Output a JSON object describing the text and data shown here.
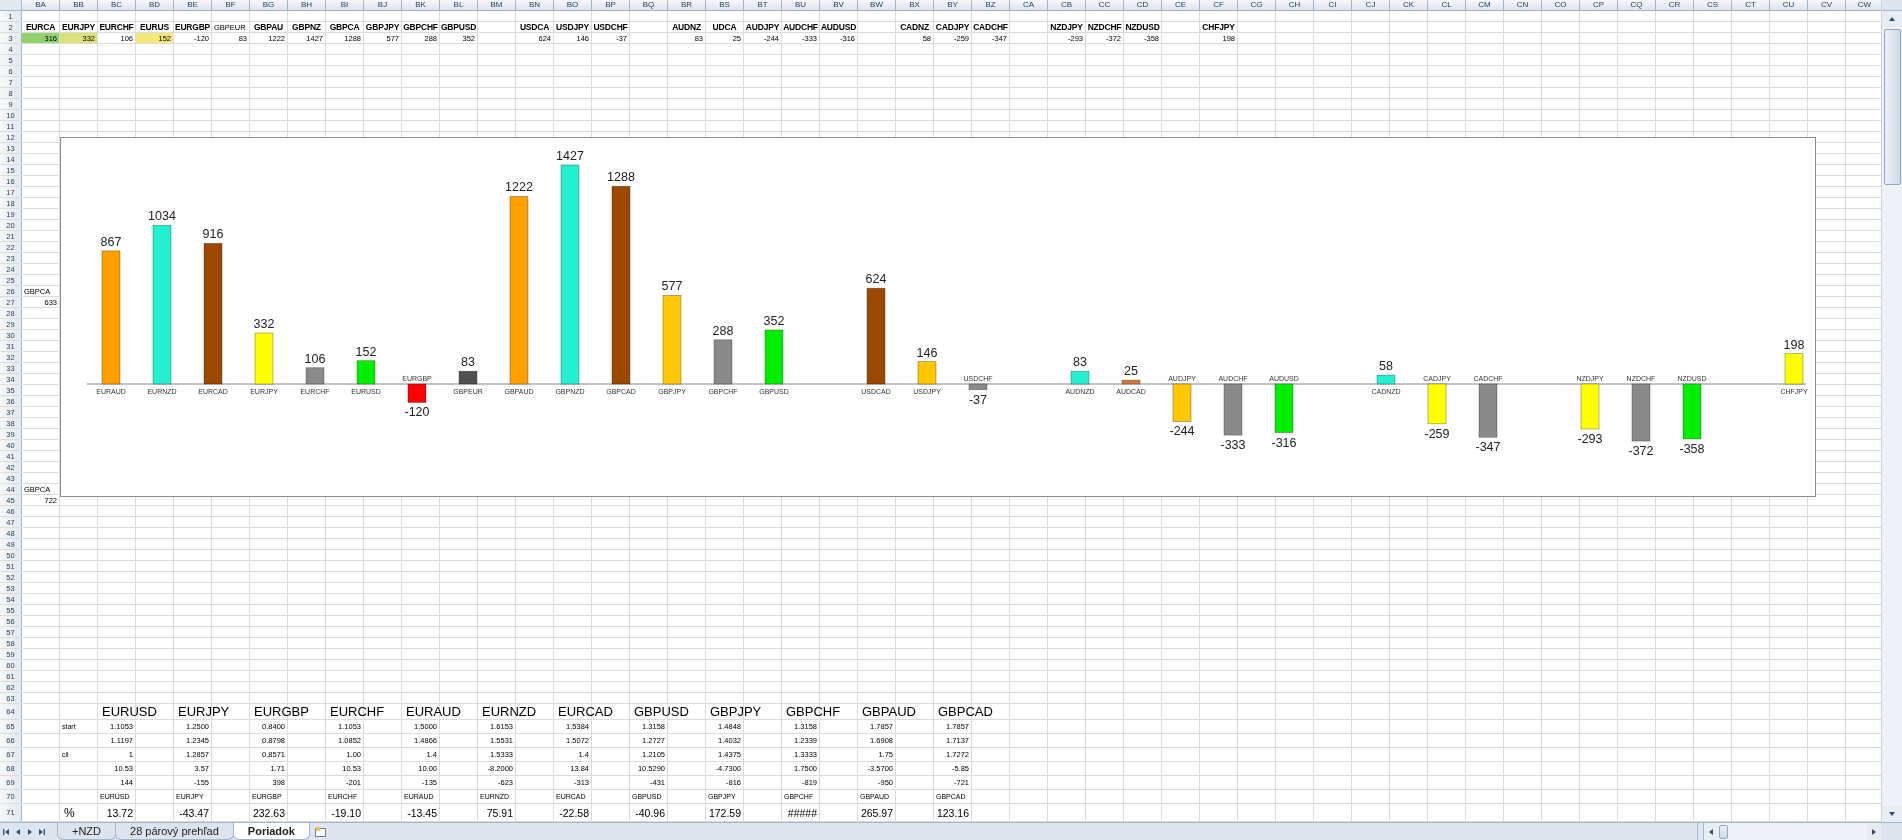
{
  "sheet": {
    "columns": [
      "BA",
      "BB",
      "BC",
      "BD",
      "BE",
      "BF",
      "BG",
      "BH",
      "BI",
      "BJ",
      "BK",
      "BL",
      "BM",
      "BN",
      "BO",
      "BP",
      "BQ",
      "BR",
      "BS",
      "BT",
      "BU",
      "BV",
      "BW",
      "BX",
      "BY",
      "BZ",
      "CA",
      "CB",
      "CC",
      "CD",
      "CE",
      "CF",
      "CG",
      "CH",
      "CI",
      "CJ",
      "CK",
      "CL",
      "CM",
      "CN",
      "CO",
      "CP",
      "CQ",
      "CR",
      "CS",
      "CT",
      "CU",
      "CV",
      "CW"
    ],
    "row_numbers": [
      "1",
      "2",
      "3",
      "4",
      "5",
      "6",
      "7",
      "8",
      "9",
      "10",
      "11",
      "12",
      "13",
      "14",
      "15",
      "16",
      "17",
      "18",
      "19",
      "20",
      "21",
      "22",
      "23",
      "24",
      "25",
      "26",
      "27",
      "28",
      "29",
      "30",
      "31",
      "32",
      "33",
      "34",
      "35",
      "36",
      "37",
      "38",
      "39",
      "40",
      "41",
      "42",
      "43",
      "44",
      "45",
      "46",
      "47",
      "48",
      "49",
      "50",
      "51",
      "52",
      "53",
      "54",
      "55",
      "56",
      "57",
      "58",
      "59",
      "60",
      "61",
      "62",
      "63",
      "64",
      "65",
      "66",
      "67",
      "68",
      "69",
      "70",
      "71"
    ],
    "pair_groups": [
      [
        {
          "pair": "EURCA",
          "kind": "bold",
          "value": "316",
          "color": "#92d36e"
        },
        {
          "pair": "EURJPY",
          "kind": "bold",
          "value": "332",
          "color": "#dbe27a"
        },
        {
          "pair": "EURCHF",
          "kind": "bold",
          "value": "106"
        },
        {
          "pair": "EURUS",
          "kind": "bold",
          "value": "152",
          "color": "#f6e77b"
        },
        {
          "pair": "EURGBP",
          "kind": "bold",
          "value": "-120"
        },
        {
          "pair": "GBPEUR",
          "kind": "plain",
          "value": "83"
        },
        {
          "pair": "GBPAU",
          "kind": "bold",
          "value": "1222"
        },
        {
          "pair": "GBPNZ",
          "kind": "bold",
          "value": "1427"
        },
        {
          "pair": "GBPCA",
          "kind": "bold",
          "value": "1288"
        },
        {
          "pair": "GBPJPY",
          "kind": "bold",
          "value": "577"
        },
        {
          "pair": "GBPCHF",
          "kind": "bold",
          "value": "288"
        },
        {
          "pair": "GBPUSD",
          "kind": "bold",
          "value": "352"
        }
      ],
      [
        {
          "pair": "USDCA",
          "kind": "bold",
          "value": "624"
        },
        {
          "pair": "USDJPY",
          "kind": "bold",
          "value": "146"
        },
        {
          "pair": "USDCHF",
          "kind": "bold",
          "value": "-37"
        }
      ],
      [
        {
          "pair": "AUDNZ",
          "kind": "bold",
          "value": "83"
        },
        {
          "pair": "UDCA",
          "kind": "bold",
          "value": "25"
        },
        {
          "pair": "AUDJPY",
          "kind": "bold",
          "value": "-244"
        },
        {
          "pair": "AUDCHF",
          "kind": "bold",
          "value": "-333"
        },
        {
          "pair": "AUDUSD",
          "kind": "bold",
          "value": "-316"
        }
      ],
      [
        {
          "pair": "CADNZ",
          "kind": "bold",
          "value": "58"
        },
        {
          "pair": "CADJPY",
          "kind": "bold",
          "value": "-259"
        },
        {
          "pair": "CADCHF",
          "kind": "bold",
          "value": "-347"
        }
      ],
      [
        {
          "pair": "NZDJPY",
          "kind": "bold",
          "value": "-293"
        },
        {
          "pair": "NZDCHF",
          "kind": "bold",
          "value": "-372"
        },
        {
          "pair": "NZDUSD",
          "kind": "bold",
          "value": "-358"
        }
      ],
      [
        {
          "pair": "CHFJPY",
          "kind": "bold",
          "value": "198"
        }
      ]
    ],
    "side_notes": [
      {
        "label": "GBPCA",
        "value": "633"
      },
      {
        "label": "GBPCA",
        "value": "722"
      }
    ],
    "chart": {
      "chart_data": {
        "type": "bar",
        "data_labels": true,
        "categories": [
          "EURAUD",
          "EURNZD",
          "EURCAD",
          "EURJPY",
          "EURCHF",
          "EURUSD",
          "EURGBP",
          "GBPEUR",
          "GBPAUD",
          "GBPNZD",
          "GBPCAD",
          "GBPJPY",
          "GBPCHF",
          "GBPUSD",
          null,
          "USDCAD",
          "USDJPY",
          "USDCHF",
          null,
          "AUDNZD",
          "AUDCAD",
          "AUDJPY",
          "AUDCHF",
          "AUDUSD",
          null,
          "CADNZD",
          "CADJPY",
          "CADCHF",
          null,
          "NZDJPY",
          "NZDCHF",
          "NZDUSD",
          null,
          "CHFJPY"
        ],
        "series": [
          {
            "values": [
              867,
              1034,
              916,
              332,
              106,
              152,
              -120,
              83,
              1222,
              1427,
              1288,
              577,
              288,
              352,
              null,
              624,
              146,
              -37,
              null,
              83,
              25,
              -244,
              -333,
              -316,
              null,
              58,
              -259,
              -347,
              null,
              -293,
              -372,
              -358,
              null,
              198
            ]
          }
        ],
        "colors": [
          "#ffa000",
          "#22f0d0",
          "#9c4800",
          "#ffff00",
          "#8a8a8a",
          "#00ee00",
          "#ff0000",
          "#505050",
          "#ffa000",
          "#22f0d0",
          "#9c4800",
          "#ffc800",
          "#8a8a8a",
          "#00ee00",
          null,
          "#9c4800",
          "#ffc800",
          "#8a8a8a",
          null,
          "#22f0d0",
          "#d2793a",
          "#ffc800",
          "#8a8a8a",
          "#00ee00",
          null,
          "#22f0d0",
          "#ffff00",
          "#8a8a8a",
          null,
          "#ffff00",
          "#8a8a8a",
          "#00ee00",
          null,
          "#ffff00"
        ]
      }
    },
    "summary": {
      "start_label": "start",
      "target_label": "cil",
      "percent_label": "%",
      "columns": [
        {
          "pair": "EURUSD",
          "values": [
            "1.1053",
            "1.1197",
            "1",
            "10.53",
            "144"
          ],
          "code": "EURUSD",
          "percent": "13.72"
        },
        {
          "pair": "EURJPY",
          "values": [
            "1.2500",
            "1.2345",
            "1.2857",
            "3.57",
            "-155"
          ],
          "code": "EURJPY",
          "percent": "-43.47"
        },
        {
          "pair": "EURGBP",
          "values": [
            "0.8400",
            "0.8798",
            "0.8571",
            "1.71",
            "398"
          ],
          "code": "EURGBP",
          "percent": "232.63"
        },
        {
          "pair": "EURCHF",
          "values": [
            "1.1053",
            "1.0852",
            "1.00",
            "10.53",
            "-201"
          ],
          "code": "EURCHF",
          "percent": "-19.10"
        },
        {
          "pair": "EURAUD",
          "values": [
            "1.5000",
            "1.4866",
            "1.4",
            "10.00",
            "-135"
          ],
          "code": "EURAUD",
          "percent": "-13.45"
        },
        {
          "pair": "EURNZD",
          "values": [
            "1.6153",
            "1.5531",
            "1.5333",
            "-8.2000",
            "-623"
          ],
          "code": "EURNZD",
          "percent": "75.91"
        },
        {
          "pair": "EURCAD",
          "values": [
            "1.5384",
            "1.5072",
            "1.4",
            "13.84",
            "-313"
          ],
          "code": "EURCAD",
          "percent": "-22.58"
        },
        {
          "pair": "GBPUSD",
          "values": [
            "1.3158",
            "1.2727",
            "1.2105",
            "10.5290",
            "-431"
          ],
          "code": "GBPUSD",
          "percent": "-40.96"
        },
        {
          "pair": "GBPJPY",
          "values": [
            "1.4848",
            "1.4032",
            "1.4375",
            "-4.7300",
            "-816"
          ],
          "code": "GBPJPY",
          "percent": "172.59"
        },
        {
          "pair": "GBPCHF",
          "values": [
            "1.3158",
            "1.2339",
            "1.3333",
            "1.7500",
            "-819"
          ],
          "code": "GBPCHF",
          "percent": "#####"
        },
        {
          "pair": "GBPAUD",
          "values": [
            "1.7857",
            "1.6908",
            "1.75",
            "-3.5700",
            "-950"
          ],
          "code": "GBPAUD",
          "percent": "265.97"
        },
        {
          "pair": "GBPCAD",
          "values": [
            "1.7857",
            "1.7137",
            "1.7272",
            "-5.85",
            "-721"
          ],
          "code": "GBPCAD",
          "percent": "123.16"
        }
      ]
    }
  },
  "sheet_tabs": [
    {
      "label": "+NZD",
      "selected": false
    },
    {
      "label": "28 párový prehľad",
      "selected": false
    },
    {
      "label": "Poriadok",
      "selected": true
    }
  ]
}
